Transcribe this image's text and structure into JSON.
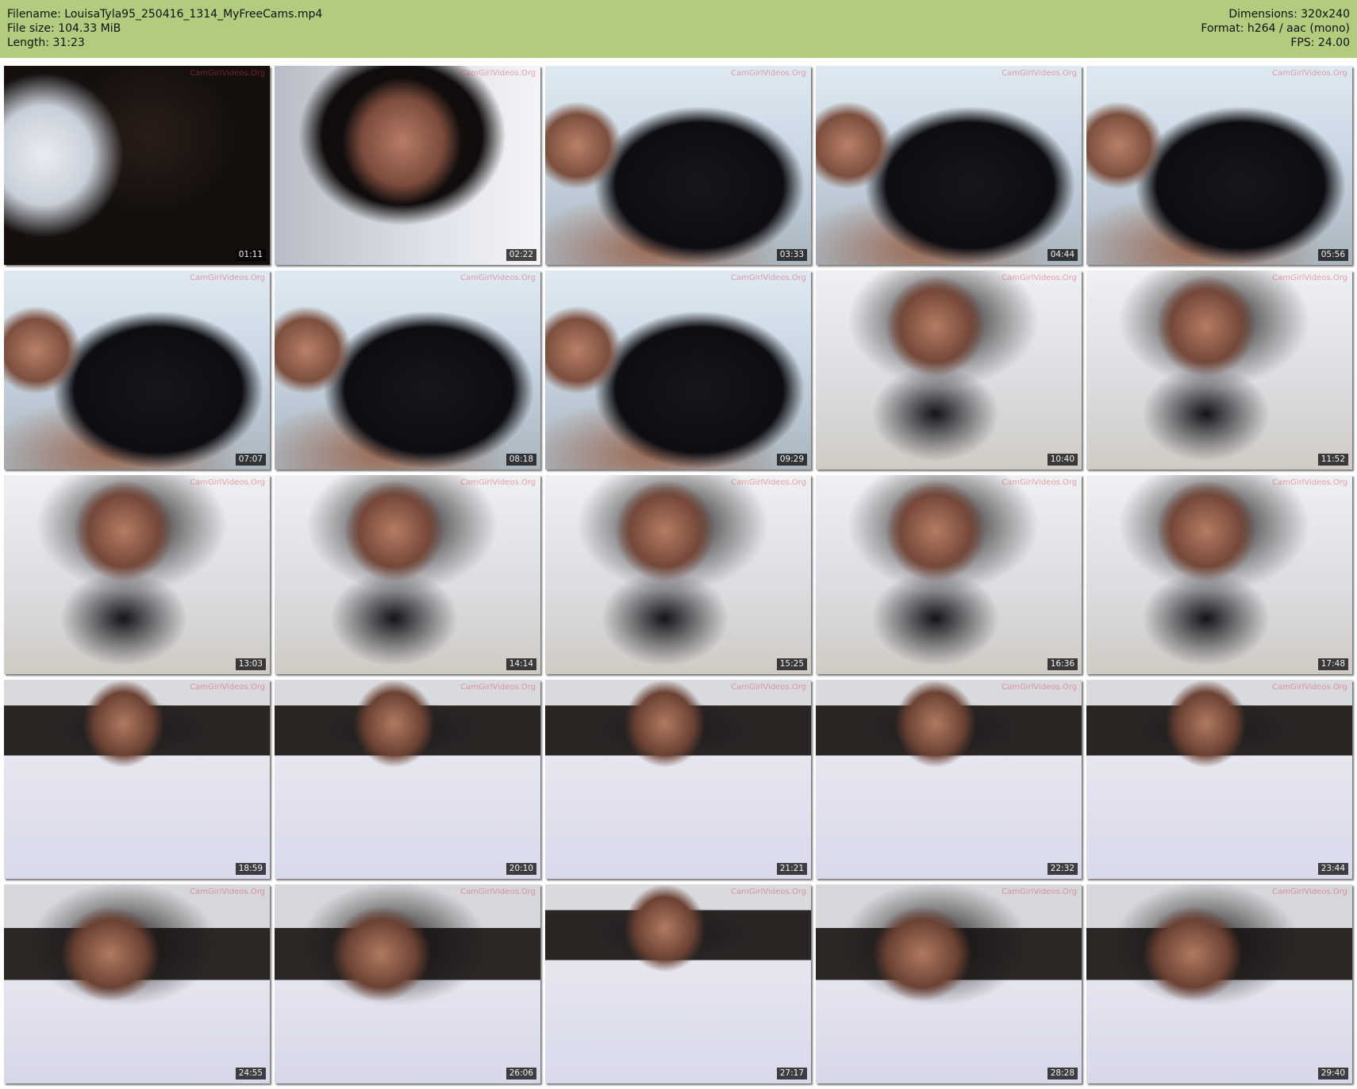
{
  "header": {
    "filename": "Filename: LouisaTyla95_250416_1314_MyFreeCams.mp4",
    "filesize": "File size: 104.33 MiB",
    "length": "Length: 31:23",
    "dimensions": "Dimensions: 320x240",
    "format": "Format: h264 / aac (mono)",
    "fps": "FPS: 24.00"
  },
  "watermark": "CamGirlVideos.Org",
  "thumbnails": [
    {
      "time": "01:11"
    },
    {
      "time": "02:22"
    },
    {
      "time": "03:33"
    },
    {
      "time": "04:44"
    },
    {
      "time": "05:56"
    },
    {
      "time": "07:07"
    },
    {
      "time": "08:18"
    },
    {
      "time": "09:29"
    },
    {
      "time": "10:40"
    },
    {
      "time": "11:52"
    },
    {
      "time": "13:03"
    },
    {
      "time": "14:14"
    },
    {
      "time": "15:25"
    },
    {
      "time": "16:36"
    },
    {
      "time": "17:48"
    },
    {
      "time": "18:59"
    },
    {
      "time": "20:10"
    },
    {
      "time": "21:21"
    },
    {
      "time": "22:32"
    },
    {
      "time": "23:44"
    },
    {
      "time": "24:55"
    },
    {
      "time": "26:06"
    },
    {
      "time": "27:17"
    },
    {
      "time": "28:28"
    },
    {
      "time": "29:40"
    }
  ],
  "colors": {
    "header_bg": "#b1cc7e",
    "timestamp_bg": "#000000"
  }
}
